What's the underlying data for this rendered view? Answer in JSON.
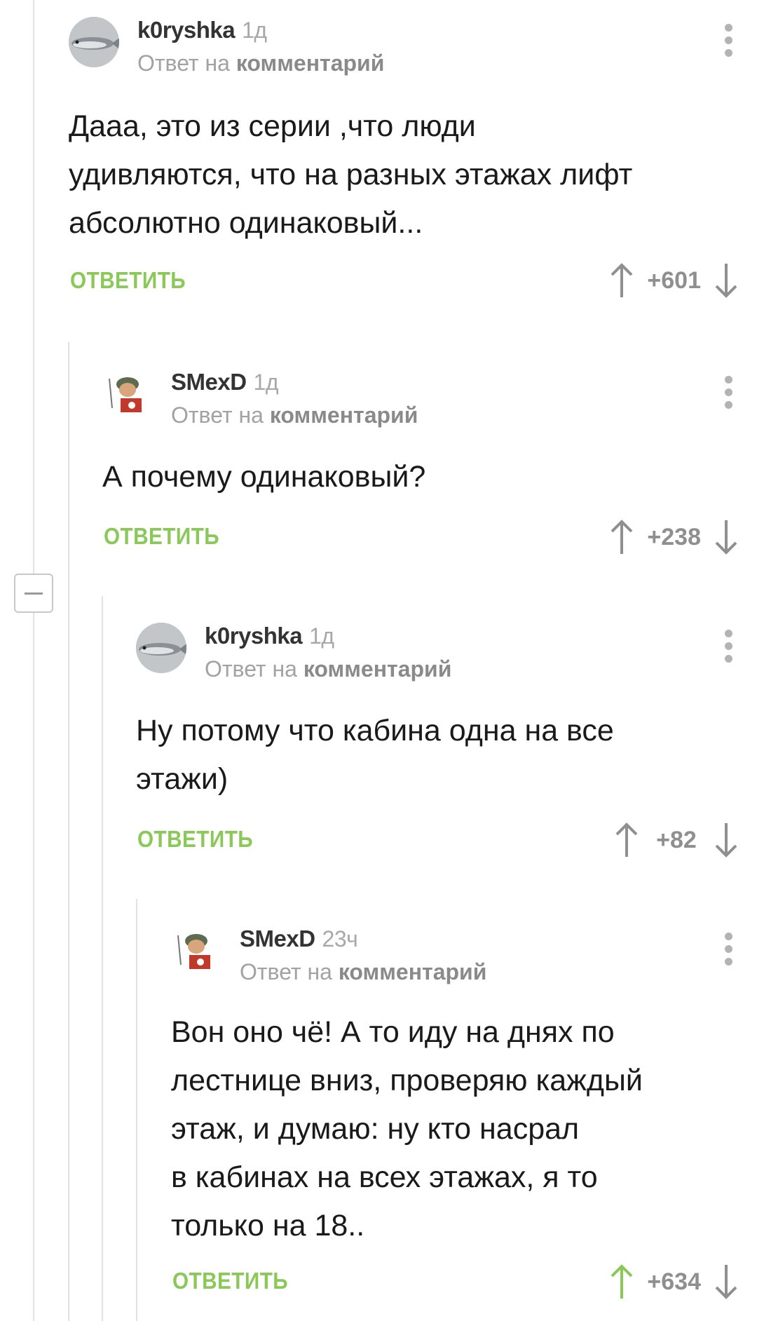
{
  "thread": {
    "comments": [
      {
        "author": "k0ryshka",
        "age": "1д",
        "reply_prefix": "Ответ на",
        "reply_target": "комментарий",
        "lines": [
          "Дааа, это из серии ,что люди",
          "удивляются, что на разных этажах лифт",
          "абсолютно одинаковый..."
        ],
        "reply_label": "ОТВЕТИТЬ",
        "score": "+601",
        "upvoted": false,
        "avatar_icon": "fish-avatar-icon"
      },
      {
        "author": "SMexD",
        "age": "1д",
        "reply_prefix": "Ответ на",
        "reply_target": "комментарий",
        "lines": [
          "А почему одинаковый?"
        ],
        "reply_label": "ОТВЕТИТЬ",
        "score": "+238",
        "upvoted": false,
        "avatar_icon": "helmet-avatar-icon"
      },
      {
        "author": "k0ryshka",
        "age": "1д",
        "reply_prefix": "Ответ на",
        "reply_target": "комментарий",
        "lines": [
          "Ну потому что кабина одна на все",
          "этажи)"
        ],
        "reply_label": "ОТВЕТИТЬ",
        "score": "+82",
        "upvoted": false,
        "avatar_icon": "fish-avatar-icon"
      },
      {
        "author": "SMexD",
        "age": "23ч",
        "reply_prefix": "Ответ на",
        "reply_target": "комментарий",
        "lines": [
          "Вон оно чё! А то иду на днях по",
          "лестнице вниз, проверяю каждый",
          "этаж, и думаю: ну кто насрал",
          "в кабинах на всех этажах, я то",
          "только на 18.."
        ],
        "reply_label": "ОТВЕТИТЬ",
        "score": "+634",
        "upvoted": true,
        "avatar_icon": "helmet-avatar-icon"
      }
    ]
  },
  "colors": {
    "accent_green": "#8ac858",
    "vote_gray": "#8f8f8f",
    "thread_line": "#e2e2e2"
  },
  "icons": [
    "menu-dots-icon",
    "upvote-arrow-icon",
    "downvote-arrow-icon",
    "collapse-minus-icon"
  ]
}
